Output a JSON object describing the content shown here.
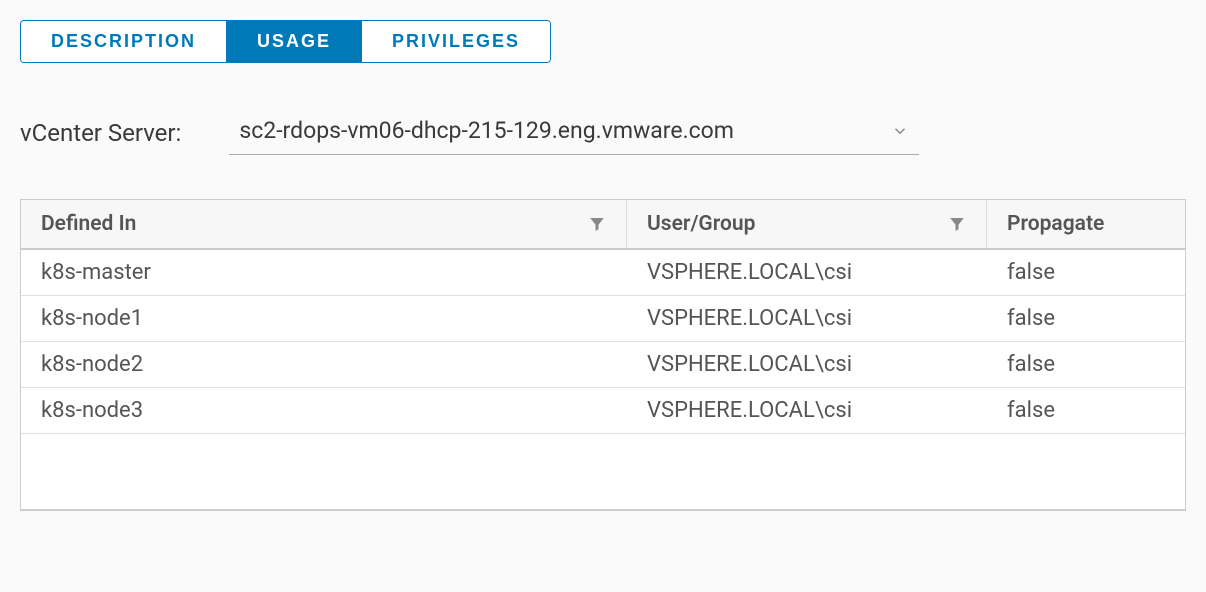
{
  "tabs": {
    "description": "DESCRIPTION",
    "usage": "USAGE",
    "privileges": "PRIVILEGES"
  },
  "selector": {
    "label": "vCenter Server:",
    "value": "sc2-rdops-vm06-dhcp-215-129.eng.vmware.com"
  },
  "table": {
    "headers": {
      "defined_in": "Defined In",
      "user_group": "User/Group",
      "propagate": "Propagate"
    },
    "rows": [
      {
        "defined_in": "k8s-master",
        "user_group": "VSPHERE.LOCAL\\csi",
        "propagate": "false"
      },
      {
        "defined_in": "k8s-node1",
        "user_group": "VSPHERE.LOCAL\\csi",
        "propagate": "false"
      },
      {
        "defined_in": "k8s-node2",
        "user_group": "VSPHERE.LOCAL\\csi",
        "propagate": "false"
      },
      {
        "defined_in": "k8s-node3",
        "user_group": "VSPHERE.LOCAL\\csi",
        "propagate": "false"
      }
    ]
  }
}
